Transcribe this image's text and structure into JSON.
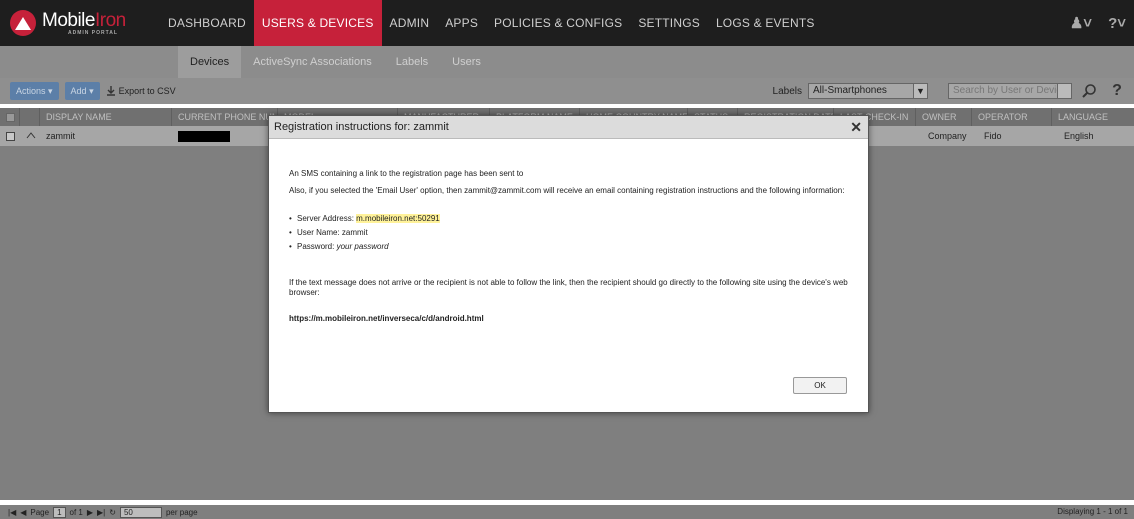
{
  "logo": {
    "word_a": "Mobile",
    "word_b": "Iron",
    "sub": "ADMIN PORTAL"
  },
  "nav": {
    "items": [
      "DASHBOARD",
      "USERS & DEVICES",
      "ADMIN",
      "APPS",
      "POLICIES & CONFIGS",
      "SETTINGS",
      "LOGS & EVENTS"
    ],
    "active": "USERS & DEVICES"
  },
  "subnav": {
    "items": [
      "Devices",
      "ActiveSync Associations",
      "Labels",
      "Users"
    ],
    "active": "Devices"
  },
  "toolbar": {
    "actions_label": "Actions",
    "add_label": "Add",
    "export_label": "Export to CSV",
    "labels_label": "Labels",
    "labels_selected": "All-Smartphones",
    "search_placeholder": "Search by User or Device"
  },
  "table": {
    "columns": [
      "DISPLAY NAME",
      "CURRENT PHONE NUMBER",
      "MODEL",
      "MANUFACTURER",
      "PLATFORM NAME",
      "HOME COUNTRY NAME",
      "STATUS",
      "REGISTRATION DATE",
      "LAST CHECK-IN",
      "OWNER",
      "OPERATOR",
      "LANGUAGE"
    ],
    "row": {
      "display_name": "zammit",
      "owner": "Company",
      "operator": "Fido",
      "language": "English"
    }
  },
  "pager": {
    "page_label": "Page",
    "page_value": "1",
    "of_label": "of 1",
    "per_page_value": "50",
    "per_page_label": "per page",
    "displaying": "Displaying 1 - 1 of 1"
  },
  "modal": {
    "title": "Registration instructions for: zammit",
    "line1": "An SMS containing a link to the registration page has been sent to",
    "line2": "Also, if you selected the 'Email User' option, then zammit@zammit.com will receive an email containing registration instructions and the following information:",
    "server_label": "Server Address: ",
    "server_value": "m.mobileiron.net:50291",
    "user_line": "User Name: zammit",
    "password_label": "Password: ",
    "password_value": "your password",
    "line3": "If the text message does not arrive or the recipient is not able to follow the link, then the recipient should go directly to the following site using the device's web browser:",
    "url": "https://m.mobileiron.net/inverseca/c/d/android.html",
    "ok_label": "OK"
  },
  "colors": {
    "accent": "#c6213a",
    "nav_bg": "#1e1e1e",
    "highlight": "#fff29a"
  }
}
